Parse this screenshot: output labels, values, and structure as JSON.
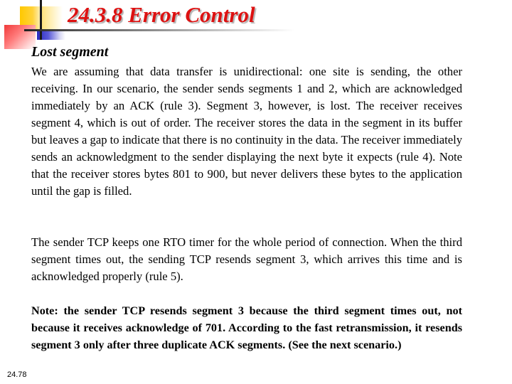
{
  "slide": {
    "title": "24.3.8  Error Control",
    "subtitle": "Lost segment",
    "paragraphs": [
      "We are assuming that data transfer is unidirectional: one site is sending, the other receiving. In our scenario, the sender sends segments 1 and 2, which are acknowledged immediately by an ACK (rule 3). Segment 3, however, is lost. The receiver receives segment 4, which is out of order. The receiver stores the data in the segment in its buffer but leaves a gap to indicate that there is no continuity in the data. The receiver immediately sends an acknowledgment to the sender displaying the next byte it expects (rule 4). Note that the receiver stores bytes 801 to 900, but never delivers these bytes to the application until the gap is filled.",
      "The sender TCP keeps one RTO timer for the whole period of connection. When the third segment times out, the sending TCP resends segment 3, which arrives this time and is acknowledged properly (rule 5).",
      "Note: the sender TCP resends segment 3 because the third segment times out, not because it receives acknowledge of 701. According to the fast retransmission, it resends segment 3 only after three duplicate ACK segments. (See the next scenario.)"
    ],
    "slide_number": "24.78"
  },
  "colors": {
    "title": "#dd1111",
    "deco_yellow": "#ffc800",
    "deco_red": "#f03a3a",
    "deco_blue": "#2a2ac0"
  }
}
